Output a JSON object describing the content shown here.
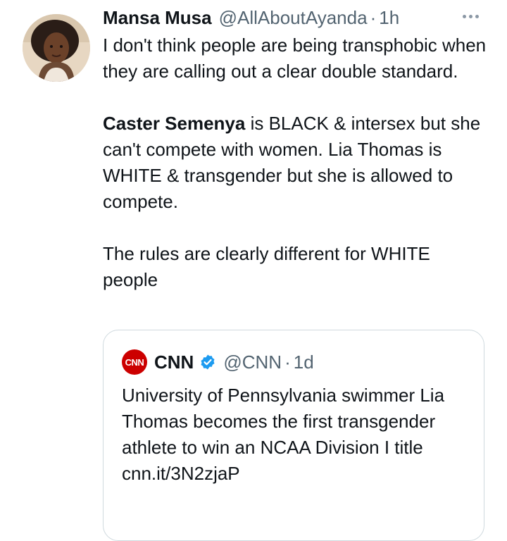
{
  "tweet": {
    "author_name": "Mansa Musa",
    "handle": "@AllAboutAyanda",
    "separator": "·",
    "time": "1h",
    "avatar_icon": "profile-photo",
    "more_icon": "more-options-icon",
    "paragraph1": "I don't think people are being transphobic when they are calling out a clear double standard.",
    "paragraph2_bold": "Caster Semenya",
    "paragraph2_rest": " is BLACK & intersex but she can't compete with women. Lia Thomas is WHITE & transgender but she is allowed to compete.",
    "paragraph3": "The rules are clearly different for WHITE people"
  },
  "quote": {
    "logo_text": "CNN",
    "author_name": "CNN",
    "verified_icon": "verified-badge-icon",
    "handle": "@CNN",
    "separator": "·",
    "time": "1d",
    "text": "University of Pennsylvania swimmer Lia Thomas becomes the first transgender athlete to win an NCAA Division I title",
    "link": "cnn.it/3N2zjaP"
  },
  "colors": {
    "text": "#0f1419",
    "secondary": "#536471",
    "border": "#cfd9de",
    "verified": "#1d9bf0",
    "cnn_red": "#cc0000"
  }
}
